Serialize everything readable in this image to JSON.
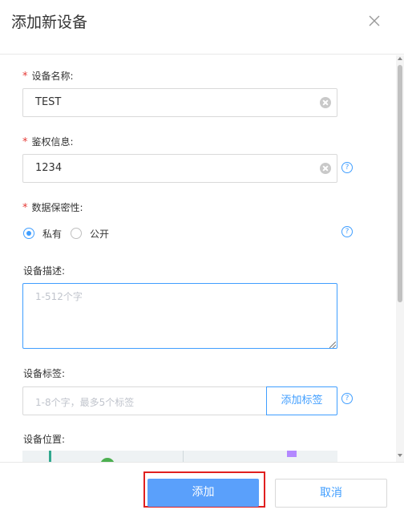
{
  "dialog": {
    "title": "添加新设备"
  },
  "form": {
    "name": {
      "label": "设备名称:",
      "value": "TEST"
    },
    "auth": {
      "label": "鉴权信息:",
      "value": "1234"
    },
    "privacy": {
      "label": "数据保密性:",
      "options": [
        {
          "label": "私有",
          "checked": true
        },
        {
          "label": "公开",
          "checked": false
        }
      ]
    },
    "description": {
      "label": "设备描述:",
      "placeholder": "1-512个字"
    },
    "tags": {
      "label": "设备标签:",
      "placeholder": "1-8个字，最多5个标签",
      "button": "添加标签"
    },
    "location": {
      "label": "设备位置:"
    },
    "required_mark": "*",
    "help_glyph": "?"
  },
  "footer": {
    "add_label": "添加",
    "cancel_label": "取消"
  },
  "colors": {
    "accent": "#409eff",
    "primary_button": "#5aa0fb",
    "required": "#e53935",
    "highlight": "#e02020"
  }
}
